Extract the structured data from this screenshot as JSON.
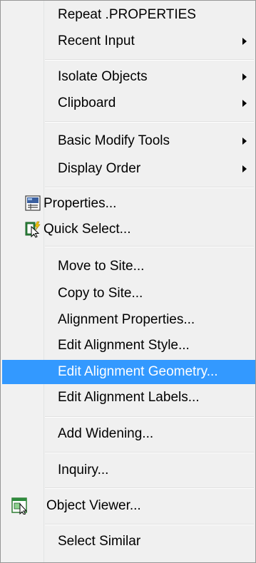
{
  "menu": {
    "items": {
      "repeat": {
        "label": "Repeat .PROPERTIES"
      },
      "recent_input": {
        "label": "Recent Input",
        "has_submenu": true
      },
      "isolate_objects": {
        "label": "Isolate Objects",
        "has_submenu": true
      },
      "clipboard": {
        "label": "Clipboard",
        "has_submenu": true
      },
      "basic_modify_tools": {
        "label": "Basic Modify Tools",
        "has_submenu": true
      },
      "display_order": {
        "label": "Display Order",
        "has_submenu": true
      },
      "properties": {
        "label": "Properties...",
        "icon": "properties-icon"
      },
      "quick_select": {
        "label": "Quick Select...",
        "icon": "quick-select-icon"
      },
      "move_to_site": {
        "label": "Move to Site..."
      },
      "copy_to_site": {
        "label": "Copy to Site..."
      },
      "alignment_properties": {
        "label": "Alignment Properties..."
      },
      "edit_alignment_style": {
        "label": "Edit Alignment Style..."
      },
      "edit_alignment_geometry": {
        "label": "Edit Alignment Geometry...",
        "highlighted": true
      },
      "edit_alignment_labels": {
        "label": "Edit Alignment Labels..."
      },
      "add_widening": {
        "label": "Add Widening..."
      },
      "inquiry": {
        "label": "Inquiry..."
      },
      "object_viewer": {
        "label": "Object Viewer...",
        "icon": "object-viewer-icon"
      },
      "select_similar": {
        "label": "Select Similar"
      }
    }
  },
  "colors": {
    "highlight": "#3399ff",
    "menu_background": "#f0f0f0",
    "border": "#979797"
  }
}
